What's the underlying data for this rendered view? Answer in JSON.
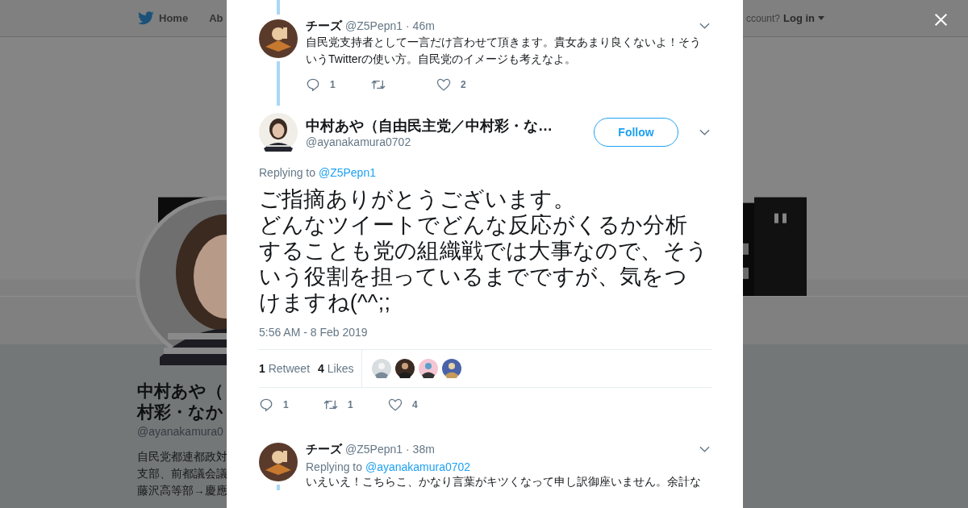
{
  "header": {
    "nav": [
      {
        "kind": "bird",
        "label": "Home"
      },
      {
        "kind": "plain",
        "label": "Ab"
      }
    ],
    "login_prompt": "ccount?",
    "login": "Log in"
  },
  "profile": {
    "name_lines": [
      "中村あや（",
      "村彩・なか"
    ],
    "handle": "@ayanakamura0",
    "bio_lines": [
      "自民党都連都政対",
      "支部、前都議会議",
      "藤沢高等部→慶應"
    ]
  },
  "tweets": [
    {
      "kind": "reply",
      "name": "チーズ",
      "handle": "@Z5Pepn1",
      "time": "· 46m",
      "text": [
        "自民党支持者として一言だけ言わせて頂きます。貴女あまり良くないよ！そう",
        "いうTwitterの使い方。自民党のイメージも考えなよ。"
      ],
      "actions": [
        {
          "kind": "reply",
          "count": "1"
        },
        {
          "kind": "retweet"
        },
        {
          "kind": "like",
          "count": "2"
        }
      ]
    },
    {
      "kind": "focus",
      "name": "中村あや（自由民主党／中村彩・な…",
      "handle": "@ayanakamura0702",
      "follow": "Follow",
      "replying_label": "Replying to",
      "replying_to": "@Z5Pepn1",
      "text": [
        "ご指摘ありがとうございます。",
        "どんなツイートでどんな反応がくるか分析",
        "することも党の組織戦では大事なので、そう",
        "いう役割を担っているまでですが、気をつ",
        "けますね(^^;;"
      ],
      "timestamp": "5:56 AM - 8 Feb 2019",
      "stats": [
        {
          "count": "1",
          "label": "Retweet"
        },
        {
          "count": "4",
          "label": "Likes"
        }
      ],
      "likers": [
        {
          "kind": "picture"
        },
        {
          "kind": "picture"
        },
        {
          "kind": "picture"
        },
        {
          "kind": "picture"
        }
      ],
      "actions": [
        {
          "kind": "reply",
          "count": "1"
        },
        {
          "kind": "retweet",
          "count": "1"
        },
        {
          "kind": "like",
          "count": "4"
        }
      ]
    },
    {
      "kind": "reply",
      "name": "チーズ",
      "handle": "@Z5Pepn1",
      "time": "· 38m",
      "replying_label": "Replying to",
      "replying_to": "@ayanakamura0702",
      "text": [
        "いえいえ！こちらこ、かなり言葉がキツくなって申し訳御座いません。余計な"
      ]
    }
  ]
}
